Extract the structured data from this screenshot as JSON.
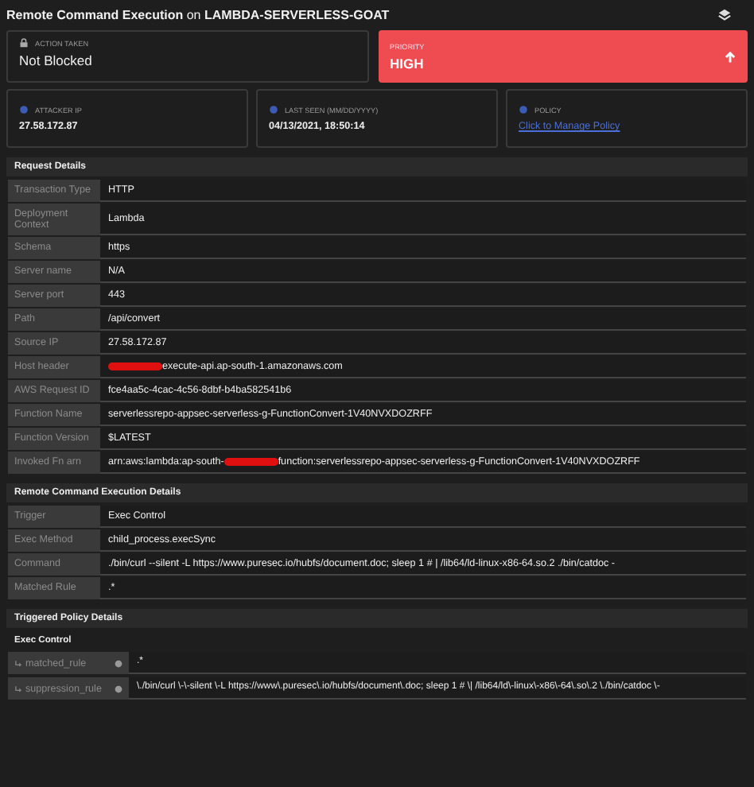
{
  "header": {
    "title_start": "Remote Command Execution",
    "title_connector": "on",
    "title_target": "LAMBDA-SERVERLESS-GOAT"
  },
  "action": {
    "label": "ACTION TAKEN",
    "value": "Not Blocked"
  },
  "priority": {
    "label": "PRIORITY",
    "value": "HIGH"
  },
  "info_cards": [
    {
      "kind": "text",
      "label": "ATTACKER IP",
      "value": "27.58.172.87"
    },
    {
      "kind": "text",
      "label": "LAST SEEN (MM/DD/YYYY)",
      "value": "04/13/2021, 18:50:14"
    },
    {
      "kind": "link",
      "label": "POLICY",
      "value": "Click to Manage Policy"
    }
  ],
  "sections": [
    {
      "title": "Request Details",
      "rows": [
        {
          "label": "Transaction Type",
          "value": "HTTP"
        },
        {
          "label": "Deployment Context",
          "value": "Lambda"
        },
        {
          "label": "Schema",
          "value": "https"
        },
        {
          "label": "Server name",
          "value": "N/A"
        },
        {
          "label": "Server port",
          "value": "443"
        },
        {
          "label": "Path",
          "value": "/api/convert"
        },
        {
          "label": "Source IP",
          "value": "27.58.172.87"
        },
        {
          "label": "Host header",
          "value": "",
          "redacted": true,
          "value_after": "execute-api.ap-south-1.amazonaws.com"
        },
        {
          "label": "AWS Request ID",
          "value": "fce4aa5c-4cac-4c56-8dbf-b4ba582541b6"
        },
        {
          "label": "Function Name",
          "value": "serverlessrepo-appsec-serverless-g-FunctionConvert-1V40NVXDOZRFF"
        },
        {
          "label": "Function Version",
          "value": "$LATEST"
        },
        {
          "label": "Invoked Fn arn",
          "value": "arn:aws:lambda:ap-south-",
          "redacted": true,
          "value_after": "function:serverlessrepo-appsec-serverless-g-FunctionConvert-1V40NVXDOZRFF"
        }
      ]
    },
    {
      "title": "Remote Command Execution Details",
      "rows": [
        {
          "label": "Trigger",
          "value": "Exec Control"
        },
        {
          "label": "Exec Method",
          "value": "child_process.execSync"
        },
        {
          "label": "Command",
          "value": "./bin/curl --silent -L https://www.puresec.io/hubfs/document.doc; sleep 1 # | /lib64/ld-linux-x86-64.so.2 ./bin/catdoc -"
        },
        {
          "label": "Matched Rule",
          "value": ".*"
        }
      ]
    }
  ],
  "policy": {
    "title": "Triggered Policy Details",
    "subtitle": "Exec Control",
    "rows": [
      {
        "label": "matched_rule",
        "value": ".*"
      },
      {
        "label": "suppression_rule",
        "value": "\\./bin/curl \\-\\-silent \\-L https://www\\.puresec\\.io/hubfs/document\\.doc; sleep 1 # \\| /lib64/ld\\-linux\\-x86\\-64\\.so\\.2 \\./bin/catdoc \\-"
      }
    ]
  }
}
